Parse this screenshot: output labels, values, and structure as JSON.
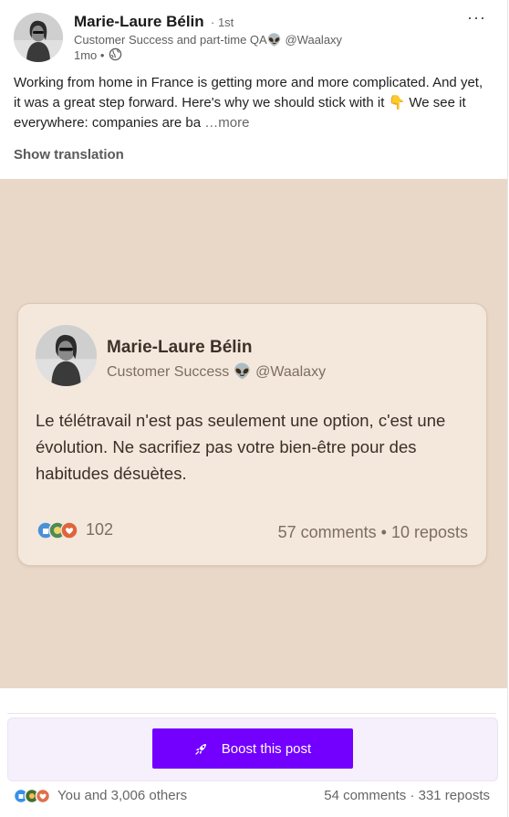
{
  "header": {
    "author_name": "Marie-Laure Bélin",
    "degree": "· 1st",
    "headline": "Customer Success and part-time QA👽 @Waalaxy",
    "time": "1mo •",
    "more_label": "···"
  },
  "post": {
    "text": "Working from home in France is getting more and more complicated. And yet, it was a great step forward. Here's why we should stick with it 👇 We see it everywhere: companies are ba",
    "see_more": "…more",
    "show_translation": "Show translation"
  },
  "media_card": {
    "background_color": "#e9d8c8",
    "author_name": "Marie-Laure Bélin",
    "headline": "Customer Success 👽 @Waalaxy",
    "text": "Le télétravail n'est pas seulement une option, c'est une évolution. Ne sacrifiez pas votre bien-être pour des habitudes désuètes.",
    "reaction_count": "102",
    "stats": "57 comments • 10 reposts"
  },
  "boost": {
    "label": "Boost this post",
    "accent_color": "#7300ff"
  },
  "footer": {
    "reactions_label": "You and 3,006 others",
    "stats": "54 comments · 331 reposts"
  }
}
